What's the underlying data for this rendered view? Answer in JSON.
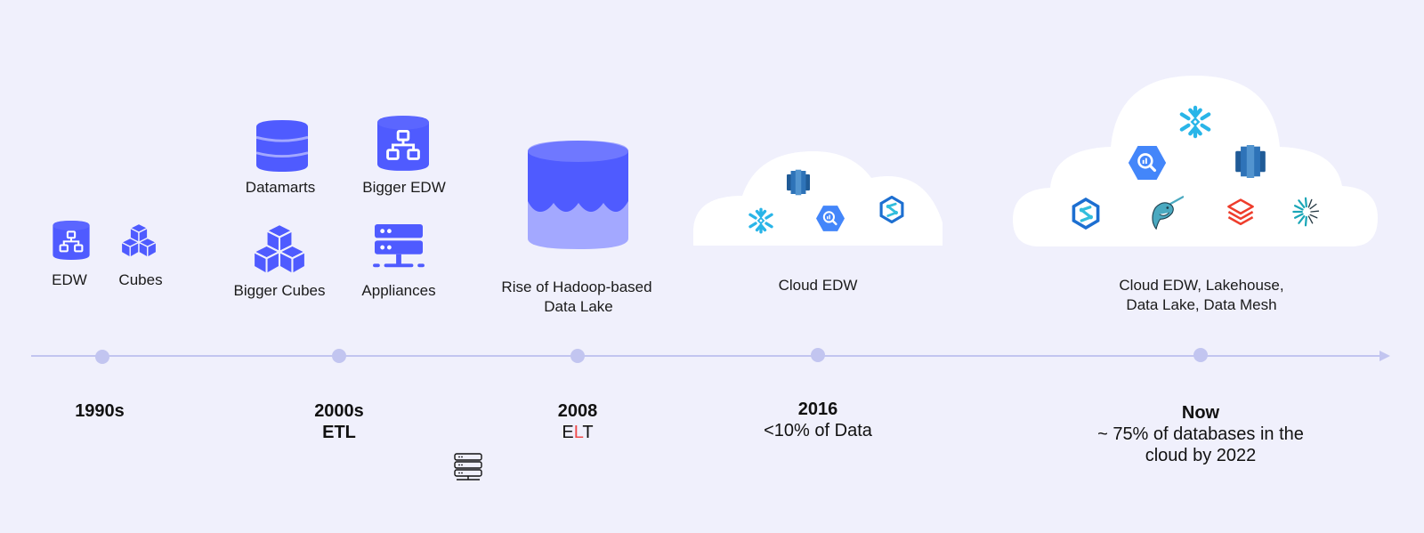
{
  "colors": {
    "background": "#f0f0fc",
    "primary_icon": "#4f5bff",
    "light_icon": "#a3a8ff",
    "timeline": "#c2c5f0",
    "highlight_red": "#f04a4a"
  },
  "stages": [
    {
      "id": "1990s",
      "items": [
        {
          "label": "EDW",
          "icon": "database-network-icon"
        },
        {
          "label": "Cubes",
          "icon": "cubes-icon"
        }
      ],
      "era": {
        "line1": "1990s",
        "line2": ""
      }
    },
    {
      "id": "2000s",
      "items": [
        {
          "label": "Datamarts",
          "icon": "database-icon"
        },
        {
          "label": "Bigger EDW",
          "icon": "database-network-icon"
        },
        {
          "label": "Bigger Cubes",
          "icon": "cubes-icon"
        },
        {
          "label": "Appliances",
          "icon": "server-icon"
        }
      ],
      "era": {
        "line1": "2000s",
        "line2": "ETL"
      }
    },
    {
      "id": "2008",
      "items": [
        {
          "label_line1": "Rise of Hadoop-based",
          "label_line2": "Data Lake",
          "icon": "data-lake-icon"
        }
      ],
      "era": {
        "line1": "2008",
        "line2_parts": [
          "E",
          "L",
          "T"
        ]
      }
    },
    {
      "id": "2016",
      "label": "Cloud EDW",
      "logos": [
        "amazon-redshift-logo",
        "snowflake-logo",
        "google-bigquery-logo",
        "azure-synapse-logo"
      ],
      "era": {
        "line1": "2016",
        "line2": "<10% of Data"
      }
    },
    {
      "id": "now",
      "label_line1": "Cloud EDW, Lakehouse,",
      "label_line2": "Data Lake, Data Mesh",
      "logos": [
        "snowflake-logo",
        "google-bigquery-logo",
        "amazon-redshift-logo",
        "azure-synapse-logo",
        "starburst-trino-logo",
        "databricks-logo",
        "dremio-logo"
      ],
      "era": {
        "line1": "Now",
        "line2": "~ 75% of databases in the",
        "line3": "cloud by 2022"
      }
    }
  ]
}
